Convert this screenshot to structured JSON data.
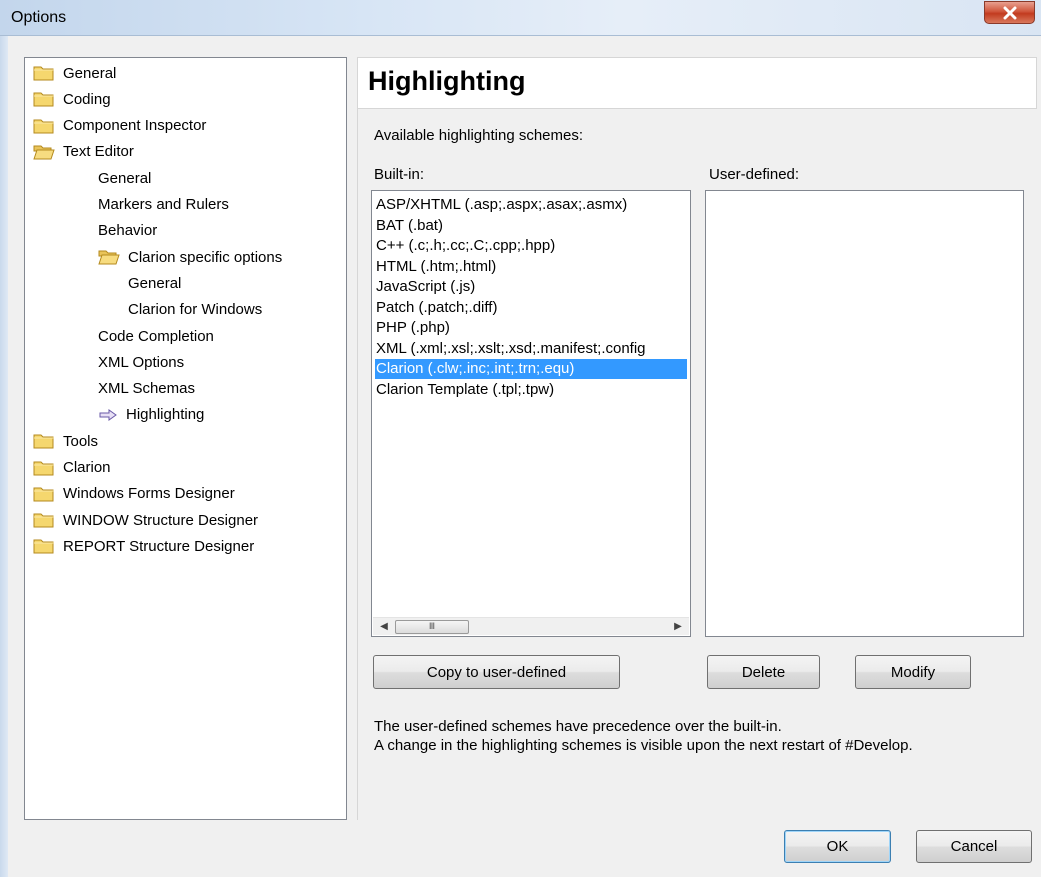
{
  "window": {
    "title": "Options"
  },
  "tree": {
    "items": [
      {
        "label": "General",
        "icon": "folder-closed-icon",
        "level": 0
      },
      {
        "label": "Coding",
        "icon": "folder-closed-icon",
        "level": 0
      },
      {
        "label": "Component Inspector",
        "icon": "folder-closed-icon",
        "level": 0
      },
      {
        "label": "Text Editor",
        "icon": "folder-open-icon",
        "level": 0
      },
      {
        "label": "General",
        "icon": "",
        "level": 1
      },
      {
        "label": "Markers and Rulers",
        "icon": "",
        "level": 1
      },
      {
        "label": "Behavior",
        "icon": "",
        "level": 1
      },
      {
        "label": "Clarion specific options",
        "icon": "folder-open-icon",
        "level": 1
      },
      {
        "label": "General",
        "icon": "",
        "level": 2
      },
      {
        "label": "Clarion for Windows",
        "icon": "",
        "level": 2
      },
      {
        "label": "Code Completion",
        "icon": "",
        "level": 1
      },
      {
        "label": "XML Options",
        "icon": "",
        "level": 1
      },
      {
        "label": "XML Schemas",
        "icon": "",
        "level": 1
      },
      {
        "label": "Highlighting",
        "icon": "arrow-right-icon",
        "level": 1
      },
      {
        "label": "Tools",
        "icon": "folder-closed-icon",
        "level": 0
      },
      {
        "label": "Clarion",
        "icon": "folder-closed-icon",
        "level": 0
      },
      {
        "label": "Windows Forms Designer",
        "icon": "folder-closed-icon",
        "level": 0
      },
      {
        "label": "WINDOW Structure Designer",
        "icon": "folder-closed-icon",
        "level": 0
      },
      {
        "label": "REPORT Structure Designer",
        "icon": "folder-closed-icon",
        "level": 0
      }
    ]
  },
  "page": {
    "title": "Highlighting",
    "available_label": "Available highlighting schemes:",
    "builtin_label": "Built-in:",
    "userdefined_label": "User-defined:",
    "builtin_items": [
      "ASP/XHTML (.asp;.aspx;.asax;.asmx)",
      "BAT (.bat)",
      "C++ (.c;.h;.cc;.C;.cpp;.hpp)",
      "HTML (.htm;.html)",
      "JavaScript (.js)",
      "Patch (.patch;.diff)",
      "PHP (.php)",
      "XML (.xml;.xsl;.xslt;.xsd;.manifest;.config",
      "Clarion (.clw;.inc;.int;.trn;.equ)",
      "Clarion Template (.tpl;.tpw)"
    ],
    "builtin_selected_index": 8,
    "userdefined_items": [],
    "copy_button": "Copy to user-defined",
    "delete_button": "Delete",
    "modify_button": "Modify",
    "note_line1": "The user-defined schemes have precedence over the built-in.",
    "note_line2": "A change in the highlighting schemes is visible upon the next restart of #Develop."
  },
  "footer": {
    "ok_button": "OK",
    "cancel_button": "Cancel"
  },
  "colors": {
    "selection": "#3399ff",
    "folder": "#f5d76e",
    "close": "#c8462a"
  }
}
